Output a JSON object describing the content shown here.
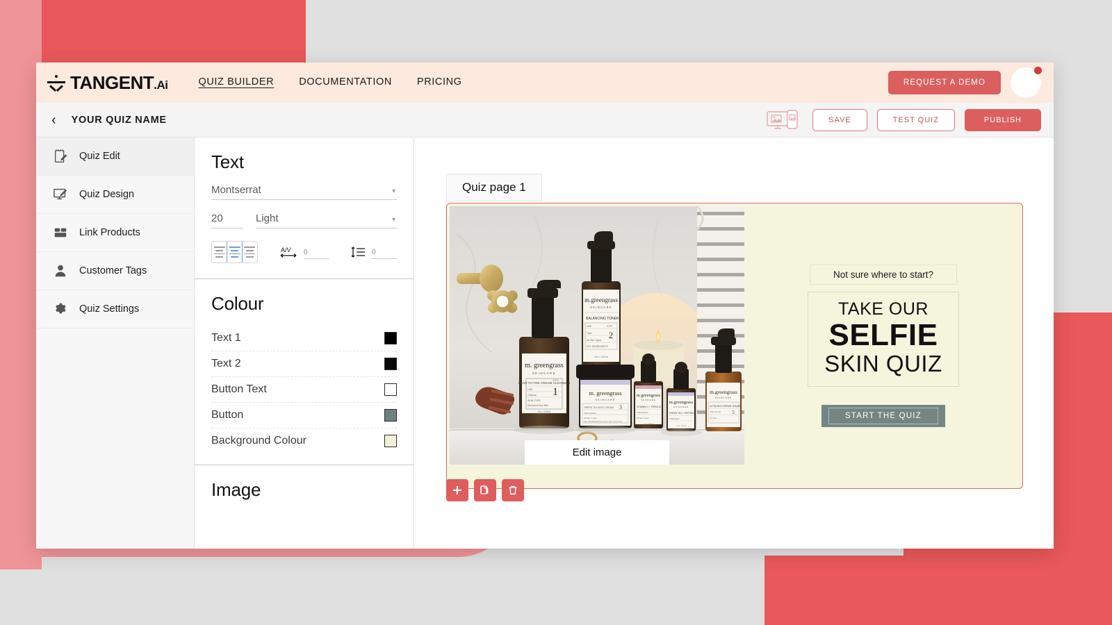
{
  "topnav": {
    "logo_text": "TANGENT",
    "logo_suffix": ".Ai",
    "links": [
      {
        "label": "QUIZ BUILDER",
        "active": true
      },
      {
        "label": "DOCUMENTATION",
        "active": false
      },
      {
        "label": "PRICING",
        "active": false
      }
    ],
    "demo_button": "REQUEST A DEMO"
  },
  "subheader": {
    "quiz_name": "YOUR QUIZ NAME",
    "save_label": "SAVE",
    "test_label": "TEST QUIZ",
    "publish_label": "PUBLISH"
  },
  "sidebar": {
    "items": [
      {
        "label": "Quiz  Edit",
        "icon": "notepad-pencil-icon",
        "active": true
      },
      {
        "label": "Quiz  Design",
        "icon": "monitor-pencil-icon",
        "active": false
      },
      {
        "label": "Link Products",
        "icon": "products-grid-icon",
        "active": false
      },
      {
        "label": "Customer Tags",
        "icon": "person-icon",
        "active": false
      },
      {
        "label": "Quiz  Settings",
        "icon": "gear-icon",
        "active": false
      }
    ]
  },
  "properties": {
    "text": {
      "title": "Text",
      "font_family": "Montserrat",
      "font_size": "20",
      "font_weight": "Light",
      "alignment": "center",
      "letter_spacing": "0",
      "line_height": "0"
    },
    "colour": {
      "title": "Colour",
      "rows": [
        {
          "label": "Text 1",
          "value": "#000000"
        },
        {
          "label": "Text 2",
          "value": "#0a0a0a"
        },
        {
          "label": "Button Text",
          "value": "#ffffff"
        },
        {
          "label": "Button",
          "value": "#6f8080"
        },
        {
          "label": "Background Colour",
          "value": "#f2f1d7"
        }
      ]
    },
    "image": {
      "title": "Image"
    }
  },
  "canvas": {
    "page_tab": "Quiz page 1",
    "edit_image_label": "Edit image",
    "sub_line": "Not sure where to start?",
    "headline_1": "TAKE OUR",
    "headline_2": "SELFIE",
    "headline_3": "SKIN QUIZ",
    "start_button": "START THE QUIZ",
    "tools": [
      {
        "name": "add-block-button",
        "glyph": "+"
      },
      {
        "name": "duplicate-block-button",
        "glyph": "❐"
      },
      {
        "name": "delete-block-button",
        "glyph": "🗑"
      }
    ]
  },
  "colors": {
    "brand_red": "#e9585a",
    "nav_cream": "#fdeade",
    "quiz_bg": "#f5f4dd",
    "button_grey": "#748585"
  }
}
